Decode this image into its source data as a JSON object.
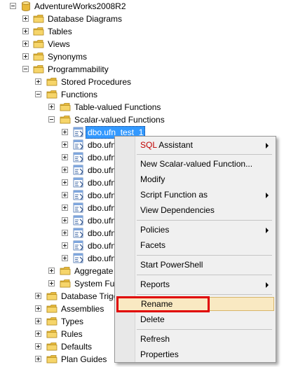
{
  "tree": {
    "root": "AdventureWorks2008R2",
    "database_diagrams": "Database Diagrams",
    "tables": "Tables",
    "views": "Views",
    "synonyms": "Synonyms",
    "programmability": "Programmability",
    "stored_procedures": "Stored Procedures",
    "functions": "Functions",
    "table_valued_functions": "Table-valued Functions",
    "scalar_valued_functions": "Scalar-valued Functions",
    "selected_function": "dbo.ufn_test_1",
    "function_items": [
      "dbo.ufn",
      "dbo.ufn",
      "dbo.ufn",
      "dbo.ufn",
      "dbo.ufn",
      "dbo.ufn",
      "dbo.ufn",
      "dbo.ufn",
      "dbo.ufn",
      "dbo.ufn"
    ],
    "aggregate_partial": "Aggregate",
    "system_functions_partial": "System Fun",
    "database_triggers_partial": "Database Trigg",
    "assemblies": "Assemblies",
    "types": "Types",
    "rules": "Rules",
    "defaults": "Defaults",
    "plan_guides": "Plan Guides"
  },
  "menu": {
    "sql_assistant_prefix": "SQL",
    "sql_assistant_label": " Assistant",
    "new_function": "New Scalar-valued Function...",
    "modify": "Modify",
    "script_function_as": "Script Function as",
    "view_dependencies": "View Dependencies",
    "policies": "Policies",
    "facets": "Facets",
    "start_powershell": "Start PowerShell",
    "reports": "Reports",
    "rename": "Rename",
    "delete": "Delete",
    "refresh": "Refresh",
    "properties": "Properties"
  },
  "colors": {
    "selection": "#3399ff",
    "highlight_box": "#e00000",
    "folder": "#f2c94c"
  }
}
